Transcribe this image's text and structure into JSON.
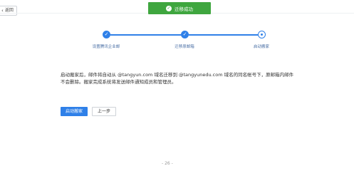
{
  "header": {
    "back_label": "返回",
    "toast_message": "迁移成功"
  },
  "steps": [
    {
      "label": "设置腾讯企业邮",
      "state": "done"
    },
    {
      "label": "迁移原邮箱",
      "state": "done"
    },
    {
      "label": "启动搬家",
      "state": "current"
    }
  ],
  "main": {
    "description": "启动搬家后，邮件将自动从 @tangyun.com 域名迁移到 @tangyunedu.com 域名的同名帐号下，原邮箱内邮件不会删除。搬家完成系统将发送邮件通知成员和管理员。",
    "primary_button": "启动搬家",
    "secondary_button": "上一步"
  },
  "footer": {
    "page_indicator": "- 26 -"
  },
  "colors": {
    "accent": "#2f80e8",
    "success": "#3fa63f"
  }
}
